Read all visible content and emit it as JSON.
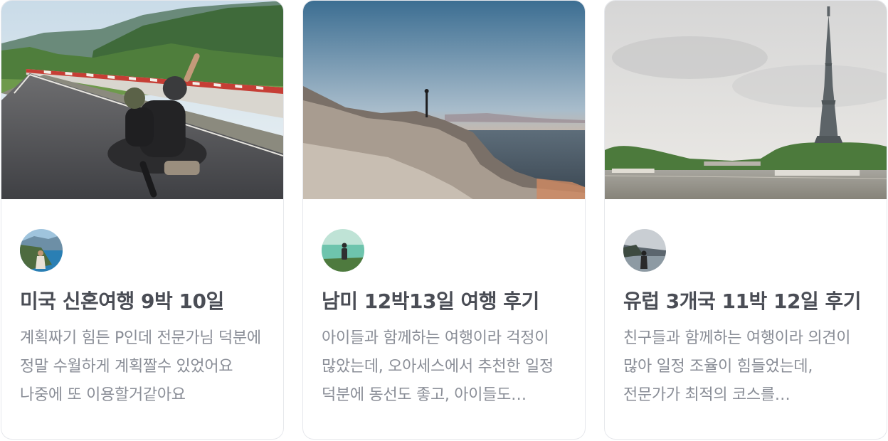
{
  "reviews": [
    {
      "title": "미국 신혼여행 9박 10일",
      "description": "계획짜기 힘든 P인데 전문가님 덕분에 정말 수월하게 계획짤수 있었어요 나중에 또 이용할거같아요",
      "photo": "motorbike-coastal-road-photo",
      "avatar": "traveler-by-lake-avatar"
    },
    {
      "title": "남미 12박13일 여행 후기",
      "description": "아이들과 함께하는 여행이라 걱정이 많았는데, 오아세스에서 추천한 일정 덕분에 동선도 좋고, 아이들도 즐거워했어요",
      "photo": "sunset-rocky-coast-photo",
      "avatar": "hiker-on-hill-avatar"
    },
    {
      "title": "유럽 3개국 11박 12일 후기",
      "description": "친구들과 함께하는 여행이라 의견이 많아 일정 조율이 힘들었는데, 전문가가 최적의 코스를 추천해주셨어요",
      "photo": "eiffel-tower-seine-photo",
      "avatar": "person-at-seaside-avatar"
    }
  ]
}
